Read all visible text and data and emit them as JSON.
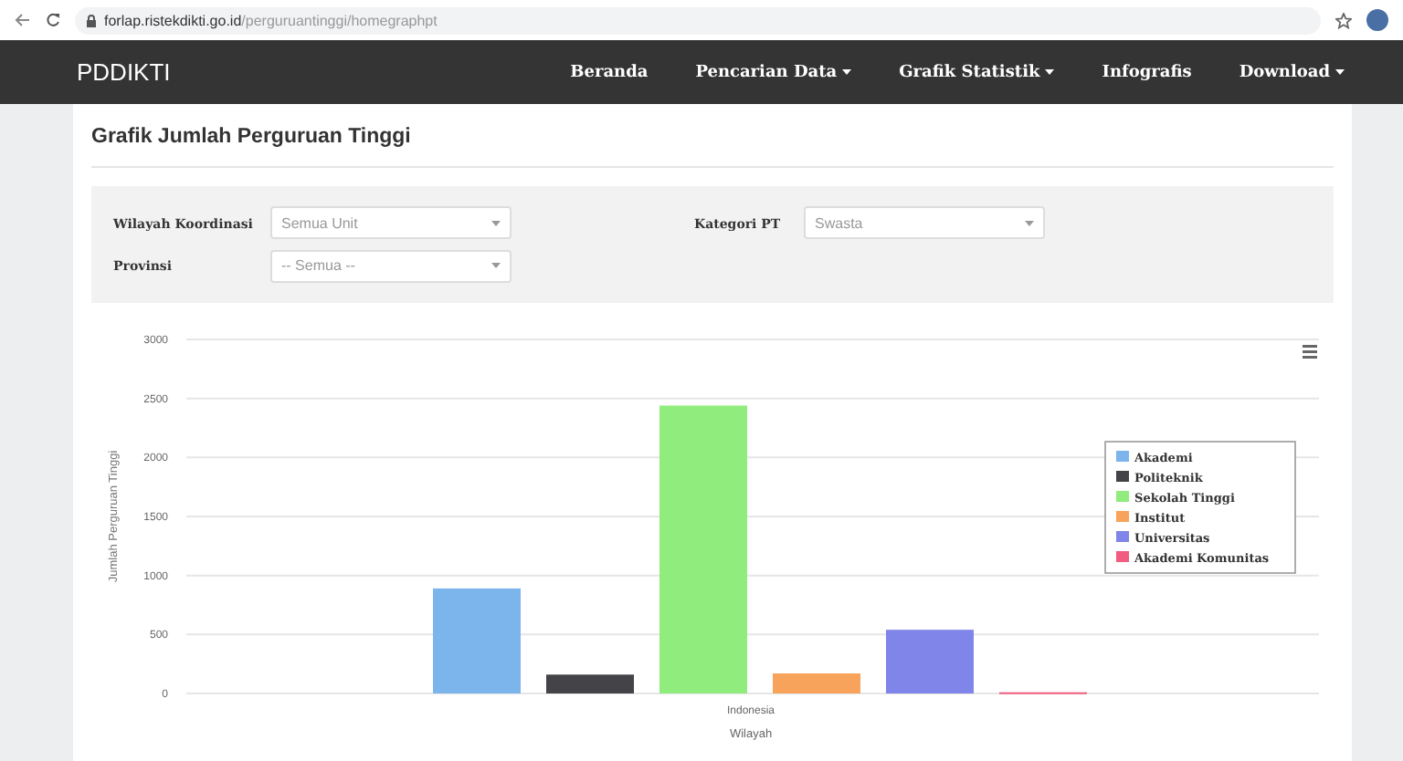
{
  "browser": {
    "url_host": "forlap.ristekdikti.go.id",
    "url_path": "/perguruantinggi/homegraphpt"
  },
  "navbar": {
    "brand": "PDDIKTI",
    "items": [
      {
        "label": "Beranda",
        "dropdown": false
      },
      {
        "label": "Pencarian Data",
        "dropdown": true
      },
      {
        "label": "Grafik Statistik",
        "dropdown": true
      },
      {
        "label": "Infografis",
        "dropdown": false
      },
      {
        "label": "Download",
        "dropdown": true
      }
    ]
  },
  "page_title": "Grafik Jumlah Perguruan Tinggi",
  "filters": [
    {
      "label": "Wilayah Koordinasi",
      "value": "Semua Unit"
    },
    {
      "label": "Kategori PT",
      "value": "Swasta"
    },
    {
      "label": "Provinsi",
      "value": "-- Semua --"
    }
  ],
  "chart": {
    "chart_data": {
      "type": "bar",
      "grid": true,
      "legend": true,
      "xlabel": "Wilayah",
      "ylabel": "Jumlah Perguruan Tinggi",
      "categories": [
        "Indonesia"
      ],
      "ylim": [
        0,
        3000
      ],
      "yticks": [
        0,
        500,
        1000,
        1500,
        2000,
        2500,
        3000
      ],
      "series": [
        {
          "name": "Akademi",
          "color": "#7cb5ec",
          "values": [
            890
          ]
        },
        {
          "name": "Politeknik",
          "color": "#434348",
          "values": [
            160
          ]
        },
        {
          "name": "Sekolah Tinggi",
          "color": "#90ed7d",
          "values": [
            2440
          ]
        },
        {
          "name": "Institut",
          "color": "#f7a35c",
          "values": [
            170
          ]
        },
        {
          "name": "Universitas",
          "color": "#8085e9",
          "values": [
            540
          ]
        },
        {
          "name": "Akademi Komunitas",
          "color": "#f15c80",
          "values": [
            10
          ]
        }
      ]
    }
  }
}
